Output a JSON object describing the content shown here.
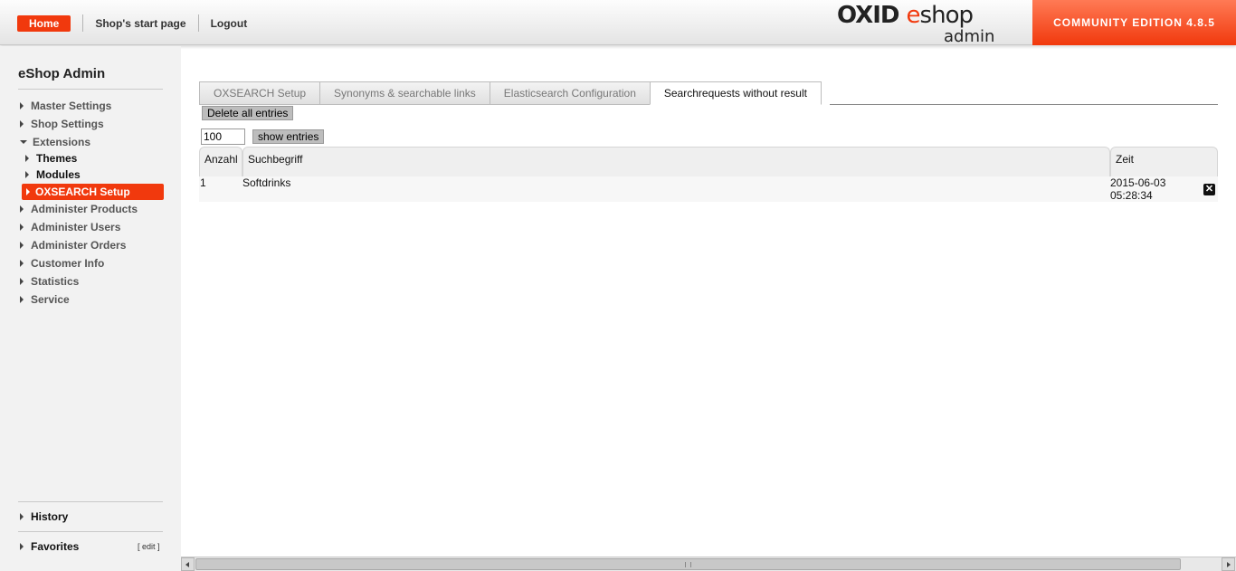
{
  "header": {
    "nav": {
      "home": "Home",
      "start_page": "Shop's start page",
      "logout": "Logout"
    },
    "logo": {
      "brand_oxid": "OXID",
      "brand_e": "e",
      "brand_shop": "shop",
      "brand_admin": "admin"
    },
    "edition": "COMMUNITY EDITION 4.8.5"
  },
  "sidebar": {
    "title": "eShop Admin",
    "items": [
      {
        "label": "Master Settings"
      },
      {
        "label": "Shop Settings"
      },
      {
        "label": "Extensions",
        "expanded": true
      },
      {
        "label": "Themes"
      },
      {
        "label": "Modules"
      },
      {
        "label": "OXSEARCH Setup",
        "active": true
      },
      {
        "label": "Administer Products"
      },
      {
        "label": "Administer Users"
      },
      {
        "label": "Administer Orders"
      },
      {
        "label": "Customer Info"
      },
      {
        "label": "Statistics"
      },
      {
        "label": "Service"
      }
    ],
    "history": "History",
    "favorites": "Favorites",
    "favorites_edit": "[ edit ]"
  },
  "main": {
    "tabs": [
      {
        "label": "OXSEARCH Setup"
      },
      {
        "label": "Synonyms & searchable links"
      },
      {
        "label": "Elasticsearch Configuration"
      },
      {
        "label": "Searchrequests without result",
        "active": true
      }
    ],
    "delete_all_label": "Delete all entries",
    "entries_count": "100",
    "show_entries_label": "show entries",
    "table": {
      "columns": [
        "Anzahl",
        "Suchbegriff",
        "Zeit"
      ],
      "rows": [
        {
          "anzahl": "1",
          "suchbegriff": "Softdrinks",
          "zeit_date": "2015-06-03",
          "zeit_time": "05:28:34"
        }
      ]
    }
  },
  "colors": {
    "accent": "#f1390d",
    "sidebar_bg": "#f2f2f2"
  }
}
